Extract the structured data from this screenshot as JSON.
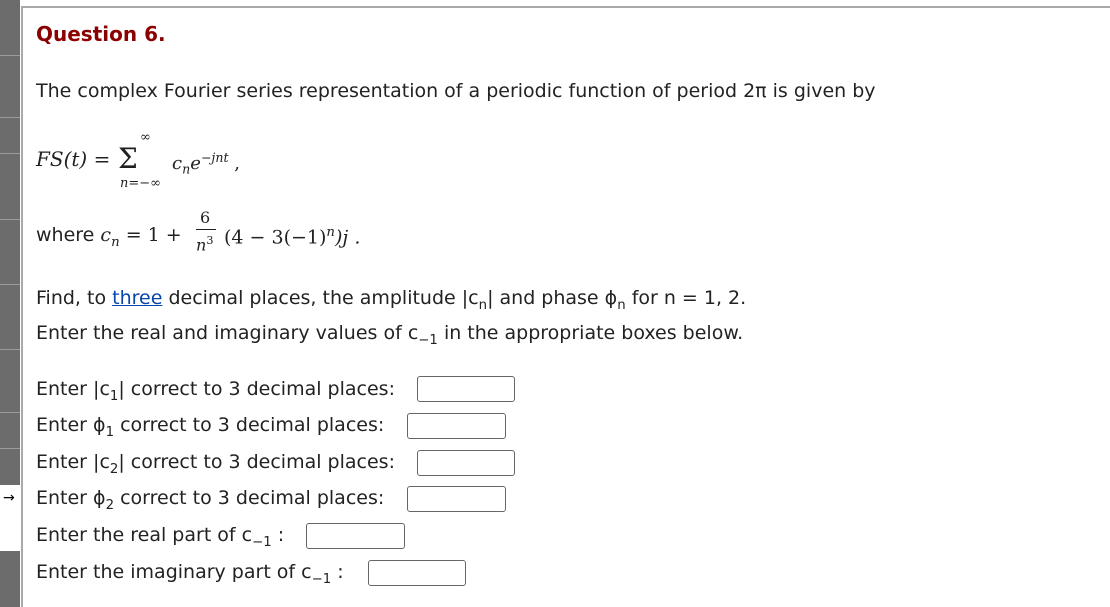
{
  "question": {
    "title": "Question 6.",
    "intro": "The complex Fourier series representation of a periodic function of period 2π is given by",
    "formula": {
      "lhs": "FS(t) =",
      "sum_upper": "∞",
      "sum_lower": "n=−∞",
      "term": "c",
      "term_sub": "n",
      "exp_base": "e",
      "exp_sup": "−jnt",
      "trailing": ","
    },
    "where": {
      "prefix": "where",
      "lhs": "c",
      "lhs_sub": "n",
      "eq": "= 1 +",
      "numerator": "6",
      "denominator": "n",
      "denominator_sup": "3",
      "rest": "(4 − 3(−1)",
      "rest_sup": "n",
      "rest_end": ")j .",
      "sigma_symbol": "Σ"
    },
    "find": {
      "prefix": "Find, to",
      "link": "three",
      "middle": "decimal places, the amplitude |c",
      "middle_sub": "n",
      "middle2": "| and phase ϕ",
      "middle2_sub": "n",
      "suffix": "for n = 1, 2."
    },
    "enter_text": {
      "prefix": "Enter the real and imaginary values of c",
      "sub": "−1",
      "suffix": "in the appropriate boxes below."
    }
  },
  "prompts": [
    {
      "pre": "Enter |c",
      "sub": "1",
      "post": "| correct to 3 decimal places:",
      "value": ""
    },
    {
      "pre": "Enter ϕ",
      "sub": "1",
      "post": "correct to 3 decimal places:",
      "value": ""
    },
    {
      "pre": "Enter |c",
      "sub": "2",
      "post": "| correct to 3 decimal places:",
      "value": ""
    },
    {
      "pre": "Enter ϕ",
      "sub": "2",
      "post": "correct to 3 decimal places:",
      "value": ""
    },
    {
      "pre": "Enter the real part of c",
      "sub": "−1",
      "post": ":",
      "value": ""
    },
    {
      "pre": "Enter the imaginary part of c",
      "sub": "−1",
      "post": ":",
      "value": ""
    }
  ],
  "sidebar": {
    "current_marker_icon": "right-arrow-icon",
    "current_marker": "→"
  }
}
